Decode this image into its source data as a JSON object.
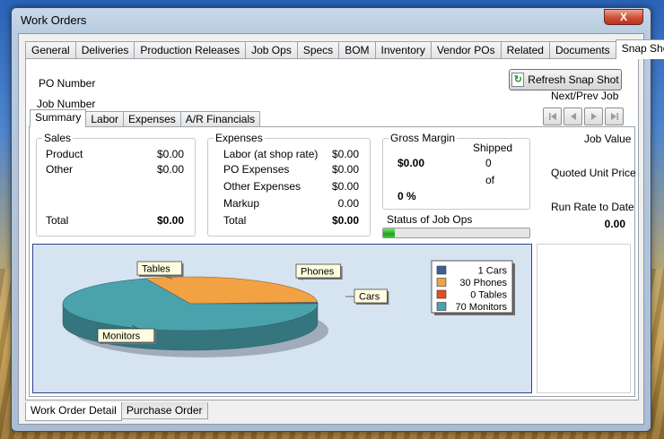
{
  "window": {
    "title": "Work Orders",
    "close_label": "X"
  },
  "tabs": [
    "General",
    "Deliveries",
    "Production Releases",
    "Job Ops",
    "Specs",
    "BOM",
    "Inventory",
    "Vendor POs",
    "Related",
    "Documents",
    "Snap Shot"
  ],
  "header": {
    "po_number_label": "PO Number",
    "job_number_label": "Job Number",
    "refresh_label": "Refresh Snap Shot",
    "next_prev_label": "Next/Prev Job"
  },
  "subtabs": [
    "Summary",
    "Labor",
    "Expenses",
    "A/R Financials"
  ],
  "sales": {
    "title": "Sales",
    "product_label": "Product",
    "product_value": "$0.00",
    "other_label": "Other",
    "other_value": "$0.00",
    "total_label": "Total",
    "total_value": "$0.00"
  },
  "expenses": {
    "title": "Expenses",
    "labor_label": "Labor (at shop rate)",
    "labor_value": "$0.00",
    "po_label": "PO Expenses",
    "po_value": "$0.00",
    "other_label": "Other Expenses",
    "other_value": "$0.00",
    "markup_label": "Markup",
    "markup_value": "0.00",
    "total_label": "Total",
    "total_value": "$0.00"
  },
  "gross_margin": {
    "title": "Gross Margin",
    "amount": "$0.00",
    "percent": "0 %",
    "shipped_label": "Shipped",
    "shipped_value": "0",
    "of_label": "of"
  },
  "status": {
    "label": "Status of Job Ops",
    "progress": 0.08
  },
  "job_value": {
    "title": "Job Value",
    "quoted_label": "Quoted Unit Price",
    "run_rate_label": "Run Rate to Date",
    "run_rate_value": "0.00"
  },
  "chart_data": {
    "type": "pie",
    "categories": [
      "Cars",
      "Phones",
      "Tables",
      "Monitors"
    ],
    "values": [
      1,
      30,
      0,
      70
    ],
    "legend": [
      "1 Cars",
      "30 Phones",
      "0 Tables",
      "70 Monitors"
    ],
    "colors": [
      "#3d5f94",
      "#f2a143",
      "#e44e25",
      "#4aa2ad"
    ],
    "legend_position": "top-right"
  },
  "bottom_tabs": [
    "Work Order Detail",
    "Purchase Order"
  ],
  "colors": {
    "accent": "#33408a",
    "chart_bg": "#d6e3f1"
  }
}
